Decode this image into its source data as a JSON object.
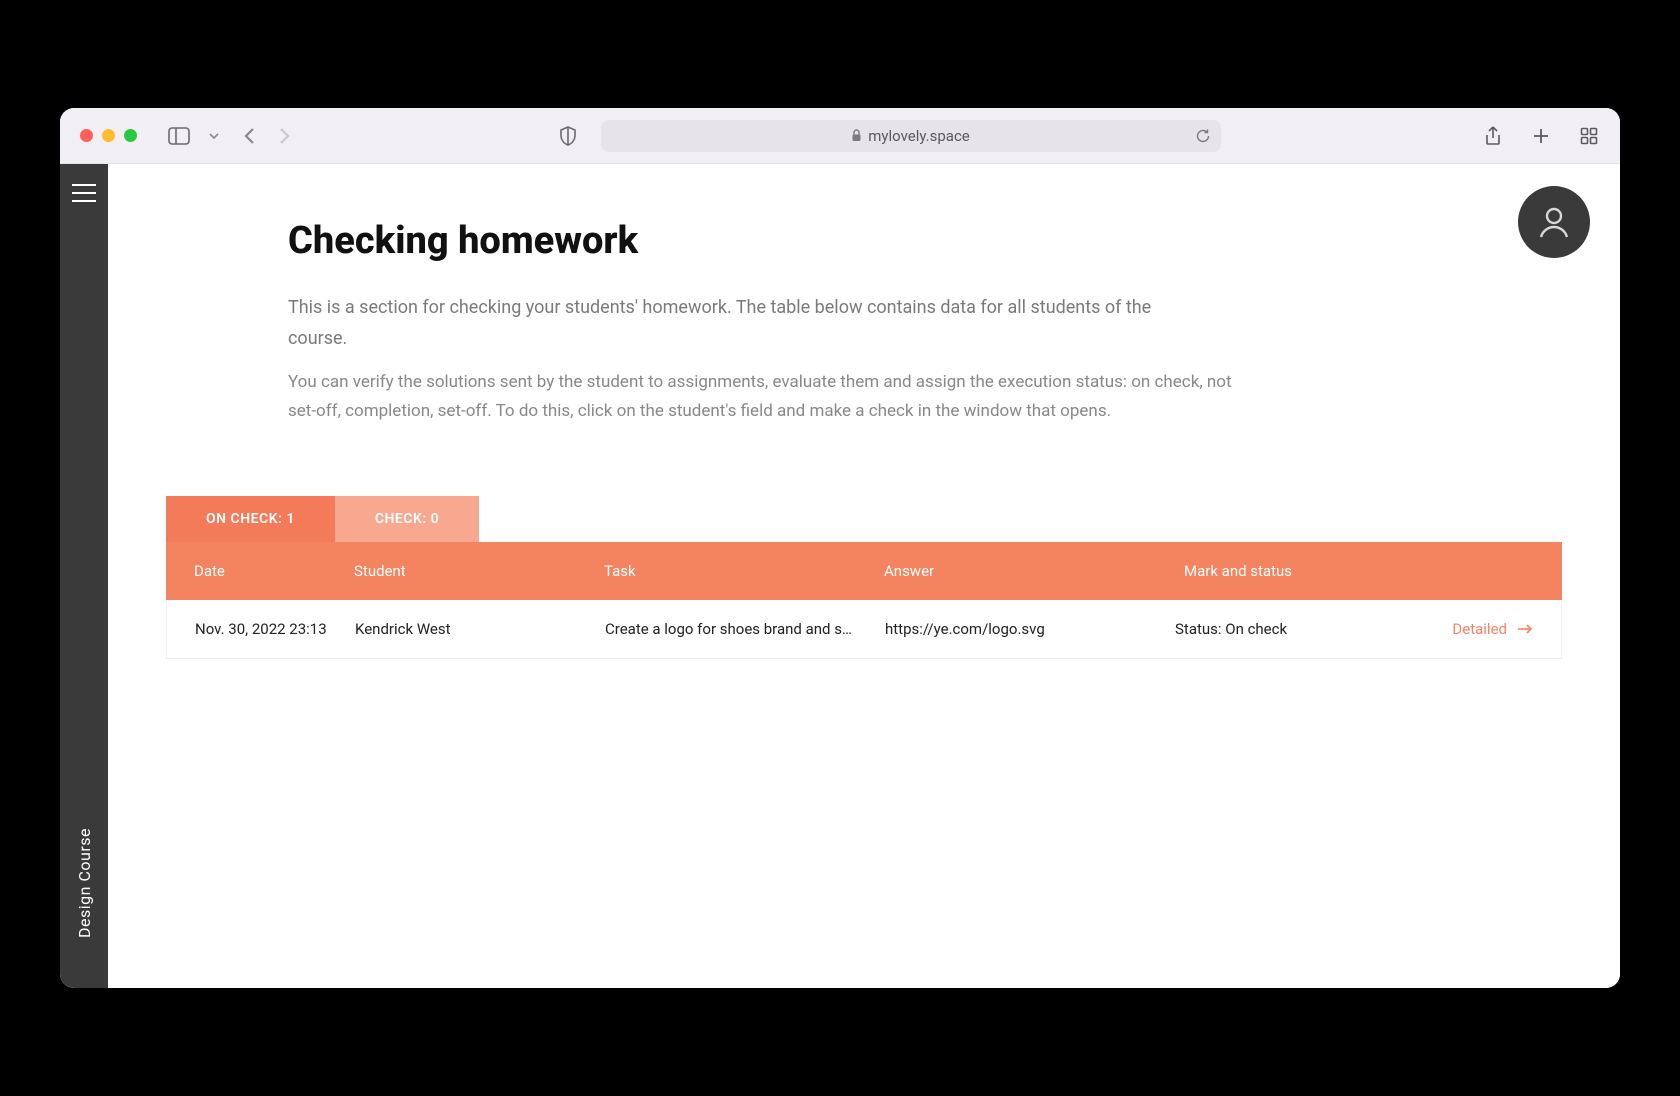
{
  "browser": {
    "url": "mylovely.space"
  },
  "sidebar": {
    "course_label": "Design Course"
  },
  "page": {
    "title": "Checking homework",
    "description1": "This is a section for checking your students' homework. The table below contains data for all students of the course.",
    "description2": "You can verify the solutions sent by the student to assignments, evaluate them and assign the execution status: on check, not set-off, completion, set-off. To do this, click on the student's field and make a check in the window that opens."
  },
  "tabs": {
    "on_check": "ON CHECK: 1",
    "check": "CHECK: 0"
  },
  "table": {
    "headers": {
      "date": "Date",
      "student": "Student",
      "task": "Task",
      "answer": "Answer",
      "mark": "Mark and status"
    },
    "rows": [
      {
        "date": "Nov. 30, 2022 23:13",
        "student": "Kendrick West",
        "task": "Create a logo for shoes brand and s…",
        "answer": "https://ye.com/logo.svg",
        "status": "Status: On check",
        "detailed": "Detailed"
      }
    ]
  }
}
